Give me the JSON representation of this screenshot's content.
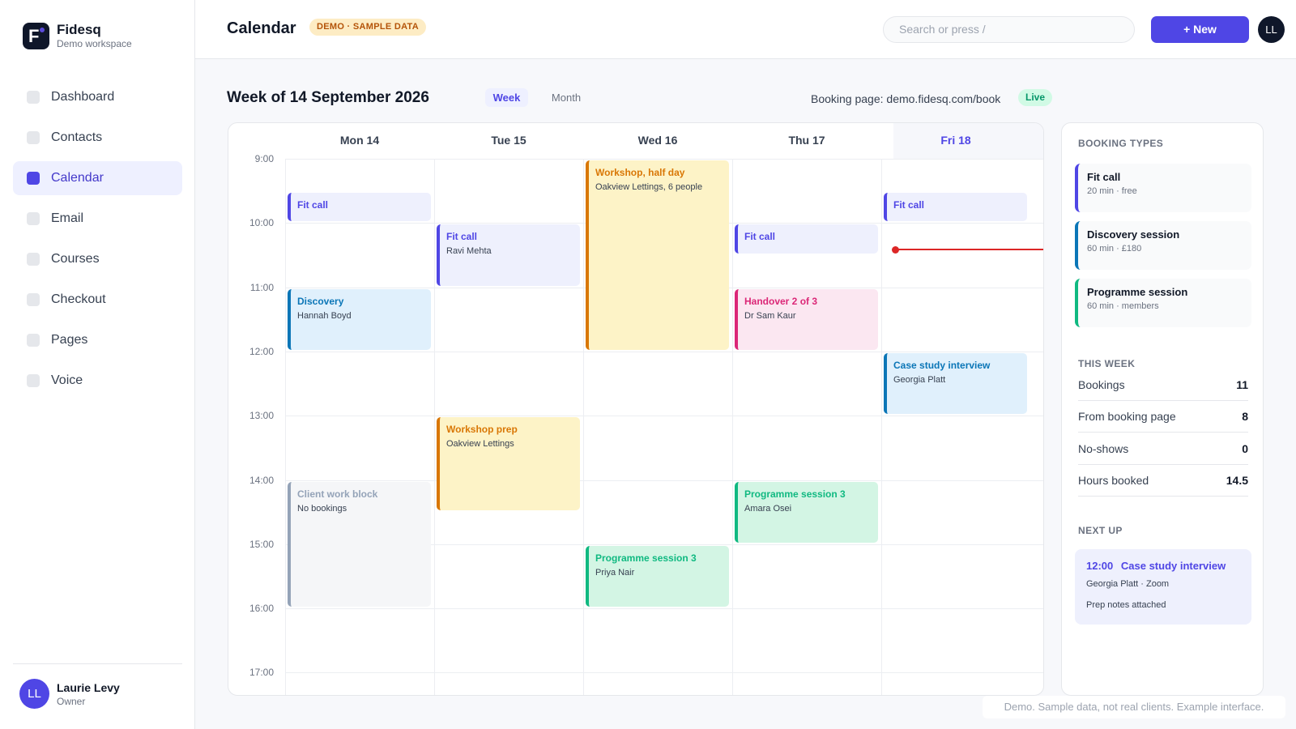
{
  "brand": {
    "name": "Fidesq",
    "subtitle": "Demo workspace",
    "logo_letter": "F"
  },
  "nav": [
    {
      "id": "dashboard",
      "label": "Dashboard",
      "active": false
    },
    {
      "id": "contacts",
      "label": "Contacts",
      "active": false
    },
    {
      "id": "calendar",
      "label": "Calendar",
      "active": true
    },
    {
      "id": "email",
      "label": "Email",
      "active": false
    },
    {
      "id": "courses",
      "label": "Courses",
      "active": false
    },
    {
      "id": "checkout",
      "label": "Checkout",
      "active": false
    },
    {
      "id": "pages",
      "label": "Pages",
      "active": false
    },
    {
      "id": "voice",
      "label": "Voice",
      "active": false
    }
  ],
  "user": {
    "initials": "LL",
    "name": "Laurie Levy",
    "role": "Owner"
  },
  "header": {
    "title": "Calendar",
    "badge": "DEMO · SAMPLE DATA",
    "search_placeholder": "Search or press /",
    "new_button": "+ New",
    "avatar_initials": "LL"
  },
  "week": {
    "title": "Week of 14 September 2026",
    "view_week": "Week",
    "view_month": "Month",
    "booking_page": "Booking page: demo.fidesq.com/book",
    "live_label": "Live"
  },
  "calendar": {
    "days": [
      {
        "label": "Mon 14",
        "today": false
      },
      {
        "label": "Tue 15",
        "today": false
      },
      {
        "label": "Wed 16",
        "today": false
      },
      {
        "label": "Thu 17",
        "today": false
      },
      {
        "label": "Fri 18",
        "today": true
      }
    ],
    "hours": [
      "9:00",
      "10:00",
      "11:00",
      "12:00",
      "13:00",
      "14:00",
      "15:00",
      "16:00",
      "17:00"
    ],
    "now_time": "10:25",
    "events": [
      {
        "day": 0,
        "start": "9:30",
        "end": "10:00",
        "title": "Fit call",
        "subtitle": "",
        "color": "indigo"
      },
      {
        "day": 0,
        "start": "11:00",
        "end": "12:00",
        "title": "Discovery",
        "subtitle": "Hannah Boyd",
        "color": "blue"
      },
      {
        "day": 0,
        "start": "14:00",
        "end": "16:00",
        "title": "Client work block",
        "subtitle": "No bookings",
        "color": "gray"
      },
      {
        "day": 1,
        "start": "10:00",
        "end": "11:00",
        "title": "Fit call",
        "subtitle": "Ravi Mehta",
        "color": "indigo"
      },
      {
        "day": 1,
        "start": "13:00",
        "end": "14:30",
        "title": "Workshop prep",
        "subtitle": "Oakview Lettings",
        "color": "amber"
      },
      {
        "day": 2,
        "start": "9:00",
        "end": "12:00",
        "title": "Workshop, half day",
        "subtitle": "Oakview Lettings, 6 people",
        "color": "amber"
      },
      {
        "day": 2,
        "start": "15:00",
        "end": "16:00",
        "title": "Programme session 3",
        "subtitle": "Priya Nair",
        "color": "green"
      },
      {
        "day": 3,
        "start": "10:00",
        "end": "10:30",
        "title": "Fit call",
        "subtitle": "",
        "color": "indigo"
      },
      {
        "day": 3,
        "start": "11:00",
        "end": "12:00",
        "title": "Handover 2 of 3",
        "subtitle": "Dr Sam Kaur",
        "color": "pink"
      },
      {
        "day": 3,
        "start": "14:00",
        "end": "15:00",
        "title": "Programme session 3",
        "subtitle": "Amara Osei",
        "color": "green"
      },
      {
        "day": 4,
        "start": "9:30",
        "end": "10:00",
        "title": "Fit call",
        "subtitle": "",
        "color": "indigo"
      },
      {
        "day": 4,
        "start": "12:00",
        "end": "13:00",
        "title": "Case study interview",
        "subtitle": "Georgia Platt",
        "color": "blue"
      }
    ]
  },
  "panel": {
    "booking_types_title": "BOOKING TYPES",
    "booking_types": [
      {
        "name": "Fit call",
        "detail": "20 min · free",
        "color": "#4f46e5"
      },
      {
        "name": "Discovery session",
        "detail": "60 min · £180",
        "color": "#0b76b7"
      },
      {
        "name": "Programme session",
        "detail": "60 min · members",
        "color": "#10b981"
      }
    ],
    "this_week_title": "THIS WEEK",
    "stats": [
      {
        "label": "Bookings",
        "value": "11"
      },
      {
        "label": "From booking page",
        "value": "8"
      },
      {
        "label": "No-shows",
        "value": "0"
      },
      {
        "label": "Hours booked",
        "value": "14.5"
      }
    ],
    "next_up_title": "NEXT UP",
    "next_up": {
      "time": "12:00",
      "title": "Case study interview",
      "meta": "Georgia Platt · Zoom",
      "note": "Prep notes attached"
    }
  },
  "footer_note": "Demo. Sample data, not real clients. Example interface."
}
